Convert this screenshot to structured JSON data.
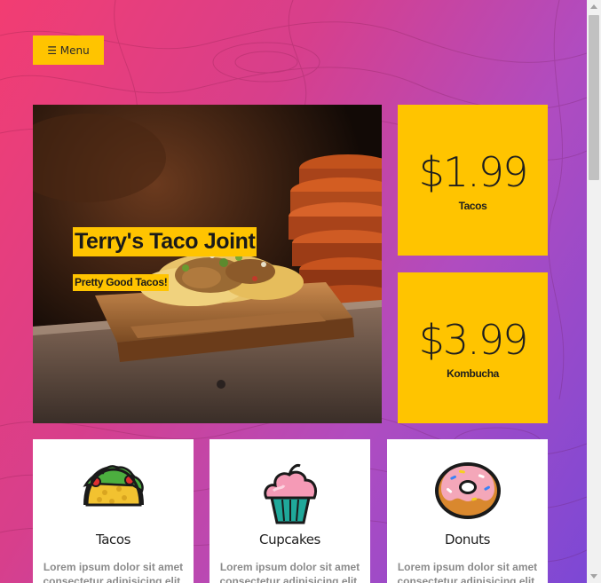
{
  "menu": {
    "icon": "hamburger-icon",
    "label": "☰ Menu"
  },
  "hero": {
    "title": "Terry's Taco Joint",
    "subtitle": "Pretty Good Tacos!",
    "image": "tacos-on-wooden-board-photo"
  },
  "prices": [
    {
      "amount": "$1.99",
      "label": "Tacos"
    },
    {
      "amount": "$3.99",
      "label": "Kombucha"
    }
  ],
  "products": [
    {
      "name": "Tacos",
      "icon": "taco-icon",
      "desc": "Lorem ipsum dolor sit amet consectetur adipisicing elit."
    },
    {
      "name": "Cupcakes",
      "icon": "cupcake-icon",
      "desc": "Lorem ipsum dolor sit amet consectetur adipisicing elit."
    },
    {
      "name": "Donuts",
      "icon": "donut-icon",
      "desc": "Lorem ipsum dolor sit amet consectetur adipisicing elit."
    }
  ],
  "colors": {
    "accent": "#ffc400",
    "gradient_start": "#f23d72",
    "gradient_end": "#7a48d6"
  }
}
